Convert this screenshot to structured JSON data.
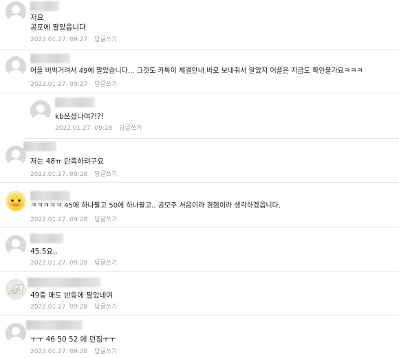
{
  "comments": [
    {
      "text": "저요\n공포에 팔았읍니다",
      "line1": "저요",
      "line2": "공포에 팔았읍니다",
      "date": "2022.01.27. 09:27",
      "reply": "답글쓰기",
      "avatar": "default-avatar-icon"
    },
    {
      "text": "어플 버벅거려서 49에 팔았습니다... 그것도 카톡이 체결안내 바로 보내줘서 알았지 어플은 지금도 확인불가요ㅋㅋㅋ",
      "date": "2022.01.27. 09:27",
      "reply": "답글쓰기",
      "avatar": "default-avatar-icon"
    },
    {
      "text": "kb쓰셨나여?!?!",
      "date": "2022.01.27. 09:28",
      "reply": "답글쓰기",
      "avatar": "default-avatar-icon"
    },
    {
      "text": "저는 48ㅠ 만족하려구요",
      "date": "2022.01.27. 09:28",
      "reply": "답글쓰기",
      "avatar": "default-avatar-icon"
    },
    {
      "text": "ㅋㅋㅋㅋㅋ 45에 하나팔고 50에 하나팔고.. 공모주 처음이라 경험이라 생각하겠읍니다.",
      "date": "2022.01.27. 09:28",
      "reply": "답글쓰기",
      "avatar": "duck-avatar-icon"
    },
    {
      "text": "45.5요..",
      "date": "2022.01.27. 09:28",
      "reply": "답글쓰기",
      "avatar": "default-avatar-icon"
    },
    {
      "text": "49중 매도 반등에 팔았네여",
      "date": "2022.01.27. 09:28",
      "reply": "답글쓰기",
      "avatar": "photo-avatar-icon"
    },
    {
      "text": "ㅜㅜ 46 50 52 에 던짐ㅜㅜ",
      "date": "2022.01.27. 09:28",
      "reply": "답글쓰기",
      "avatar": "default-avatar-icon"
    }
  ],
  "colors": {
    "divider": "#e6e6e6",
    "meta": "#a0a0a0",
    "text": "#222222",
    "avatar_bg": "#d6d6d6"
  }
}
